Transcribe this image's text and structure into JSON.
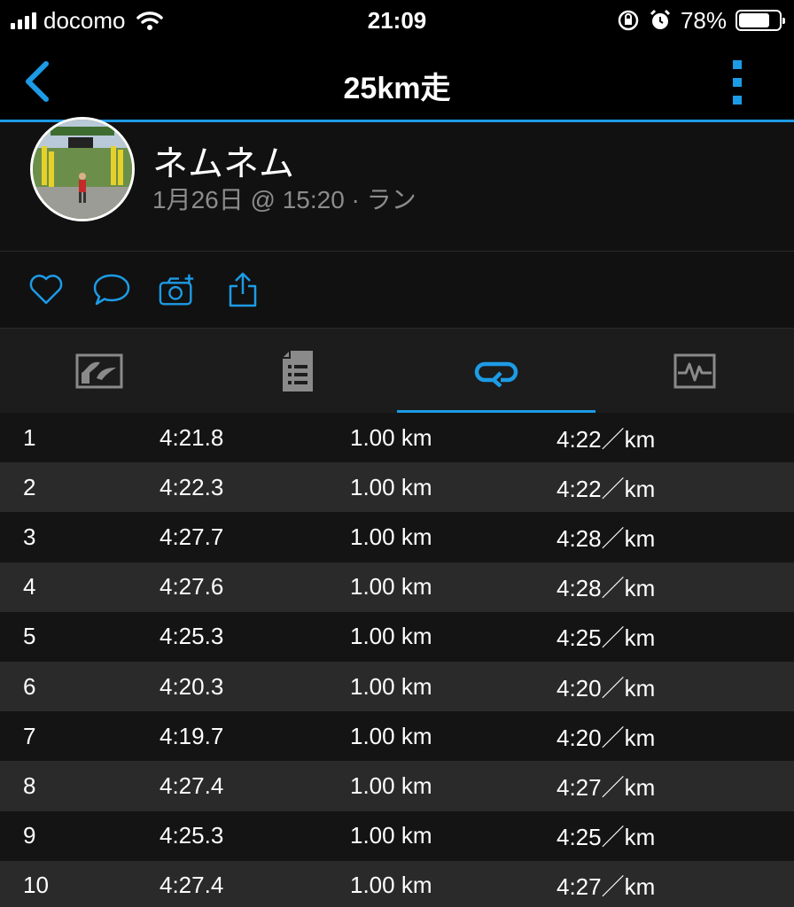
{
  "status": {
    "carrier": "docomo",
    "time": "21:09",
    "battery": "78%",
    "battery_level": 0.78
  },
  "header": {
    "title": "25km走",
    "back_icon": "chevron-left-icon",
    "more_icon": "more-vertical-icon"
  },
  "profile": {
    "name": "ネムネム",
    "meta": "1月26日 @ 15:20 · ラン"
  },
  "actions": [
    "heart-icon",
    "comment-icon",
    "camera-add-icon",
    "share-icon"
  ],
  "tabs": [
    {
      "icon": "chart-icon",
      "active": false
    },
    {
      "icon": "document-icon",
      "active": false
    },
    {
      "icon": "laps-icon",
      "active": true
    },
    {
      "icon": "heart-rate-icon",
      "active": false
    }
  ],
  "accent_color": "#1d9be6",
  "laps": [
    {
      "num": "1",
      "time": "4:21.8",
      "distance": "1.00 km",
      "pace": "4:22／km"
    },
    {
      "num": "2",
      "time": "4:22.3",
      "distance": "1.00 km",
      "pace": "4:22／km"
    },
    {
      "num": "3",
      "time": "4:27.7",
      "distance": "1.00 km",
      "pace": "4:28／km"
    },
    {
      "num": "4",
      "time": "4:27.6",
      "distance": "1.00 km",
      "pace": "4:28／km"
    },
    {
      "num": "5",
      "time": "4:25.3",
      "distance": "1.00 km",
      "pace": "4:25／km"
    },
    {
      "num": "6",
      "time": "4:20.3",
      "distance": "1.00 km",
      "pace": "4:20／km"
    },
    {
      "num": "7",
      "time": "4:19.7",
      "distance": "1.00 km",
      "pace": "4:20／km"
    },
    {
      "num": "8",
      "time": "4:27.4",
      "distance": "1.00 km",
      "pace": "4:27／km"
    },
    {
      "num": "9",
      "time": "4:25.3",
      "distance": "1.00 km",
      "pace": "4:25／km"
    },
    {
      "num": "10",
      "time": "4:27.4",
      "distance": "1.00 km",
      "pace": "4:27／km"
    }
  ]
}
